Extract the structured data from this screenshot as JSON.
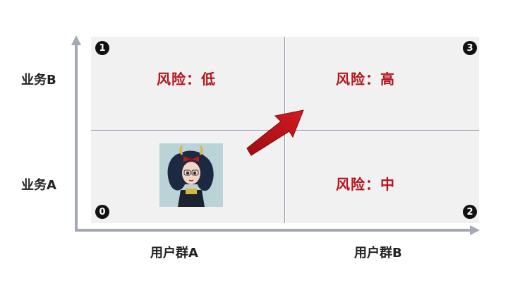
{
  "quadrants": {
    "q1": {
      "badge": "1",
      "risk": "风险：低"
    },
    "q3": {
      "badge": "3",
      "risk": "风险：高"
    },
    "q2": {
      "badge": "2",
      "risk": "风险：中"
    },
    "q0": {
      "badge": "0"
    }
  },
  "y_axis": {
    "top_label": "业务B",
    "bottom_label": "业务A"
  },
  "x_axis": {
    "left_label": "用户群A",
    "right_label": "用户群B"
  },
  "colors": {
    "risk_text": "#b3141b",
    "arrow": "#c0151c",
    "quadrant_bg": "#f1f1f1",
    "axis": "#a5a8b5"
  }
}
